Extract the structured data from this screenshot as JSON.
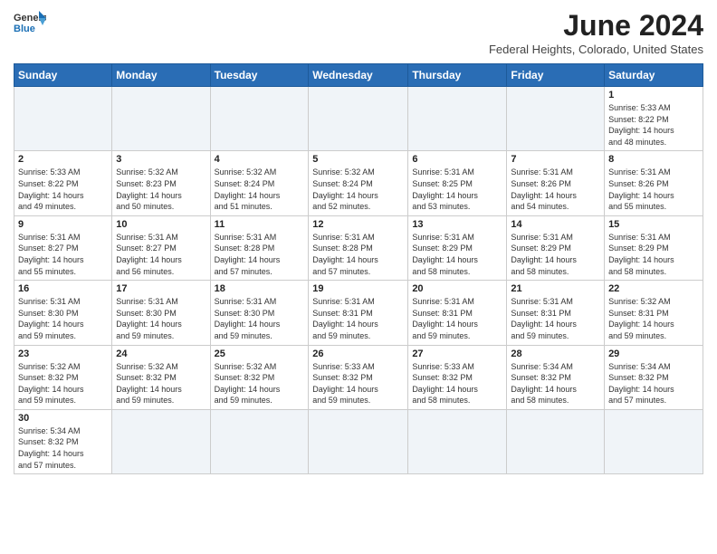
{
  "header": {
    "logo_line1": "General",
    "logo_line2": "Blue",
    "month_title": "June 2024",
    "location": "Federal Heights, Colorado, United States"
  },
  "weekdays": [
    "Sunday",
    "Monday",
    "Tuesday",
    "Wednesday",
    "Thursday",
    "Friday",
    "Saturday"
  ],
  "weeks": [
    [
      {
        "day": "",
        "info": ""
      },
      {
        "day": "",
        "info": ""
      },
      {
        "day": "",
        "info": ""
      },
      {
        "day": "",
        "info": ""
      },
      {
        "day": "",
        "info": ""
      },
      {
        "day": "",
        "info": ""
      },
      {
        "day": "1",
        "info": "Sunrise: 5:33 AM\nSunset: 8:22 PM\nDaylight: 14 hours\nand 48 minutes."
      }
    ],
    [
      {
        "day": "2",
        "info": "Sunrise: 5:33 AM\nSunset: 8:22 PM\nDaylight: 14 hours\nand 49 minutes."
      },
      {
        "day": "3",
        "info": "Sunrise: 5:32 AM\nSunset: 8:23 PM\nDaylight: 14 hours\nand 50 minutes."
      },
      {
        "day": "4",
        "info": "Sunrise: 5:32 AM\nSunset: 8:24 PM\nDaylight: 14 hours\nand 51 minutes."
      },
      {
        "day": "5",
        "info": "Sunrise: 5:32 AM\nSunset: 8:24 PM\nDaylight: 14 hours\nand 52 minutes."
      },
      {
        "day": "6",
        "info": "Sunrise: 5:31 AM\nSunset: 8:25 PM\nDaylight: 14 hours\nand 53 minutes."
      },
      {
        "day": "7",
        "info": "Sunrise: 5:31 AM\nSunset: 8:26 PM\nDaylight: 14 hours\nand 54 minutes."
      },
      {
        "day": "8",
        "info": "Sunrise: 5:31 AM\nSunset: 8:26 PM\nDaylight: 14 hours\nand 55 minutes."
      }
    ],
    [
      {
        "day": "9",
        "info": "Sunrise: 5:31 AM\nSunset: 8:27 PM\nDaylight: 14 hours\nand 55 minutes."
      },
      {
        "day": "10",
        "info": "Sunrise: 5:31 AM\nSunset: 8:27 PM\nDaylight: 14 hours\nand 56 minutes."
      },
      {
        "day": "11",
        "info": "Sunrise: 5:31 AM\nSunset: 8:28 PM\nDaylight: 14 hours\nand 57 minutes."
      },
      {
        "day": "12",
        "info": "Sunrise: 5:31 AM\nSunset: 8:28 PM\nDaylight: 14 hours\nand 57 minutes."
      },
      {
        "day": "13",
        "info": "Sunrise: 5:31 AM\nSunset: 8:29 PM\nDaylight: 14 hours\nand 58 minutes."
      },
      {
        "day": "14",
        "info": "Sunrise: 5:31 AM\nSunset: 8:29 PM\nDaylight: 14 hours\nand 58 minutes."
      },
      {
        "day": "15",
        "info": "Sunrise: 5:31 AM\nSunset: 8:29 PM\nDaylight: 14 hours\nand 58 minutes."
      }
    ],
    [
      {
        "day": "16",
        "info": "Sunrise: 5:31 AM\nSunset: 8:30 PM\nDaylight: 14 hours\nand 59 minutes."
      },
      {
        "day": "17",
        "info": "Sunrise: 5:31 AM\nSunset: 8:30 PM\nDaylight: 14 hours\nand 59 minutes."
      },
      {
        "day": "18",
        "info": "Sunrise: 5:31 AM\nSunset: 8:30 PM\nDaylight: 14 hours\nand 59 minutes."
      },
      {
        "day": "19",
        "info": "Sunrise: 5:31 AM\nSunset: 8:31 PM\nDaylight: 14 hours\nand 59 minutes."
      },
      {
        "day": "20",
        "info": "Sunrise: 5:31 AM\nSunset: 8:31 PM\nDaylight: 14 hours\nand 59 minutes."
      },
      {
        "day": "21",
        "info": "Sunrise: 5:31 AM\nSunset: 8:31 PM\nDaylight: 14 hours\nand 59 minutes."
      },
      {
        "day": "22",
        "info": "Sunrise: 5:32 AM\nSunset: 8:31 PM\nDaylight: 14 hours\nand 59 minutes."
      }
    ],
    [
      {
        "day": "23",
        "info": "Sunrise: 5:32 AM\nSunset: 8:32 PM\nDaylight: 14 hours\nand 59 minutes."
      },
      {
        "day": "24",
        "info": "Sunrise: 5:32 AM\nSunset: 8:32 PM\nDaylight: 14 hours\nand 59 minutes."
      },
      {
        "day": "25",
        "info": "Sunrise: 5:32 AM\nSunset: 8:32 PM\nDaylight: 14 hours\nand 59 minutes."
      },
      {
        "day": "26",
        "info": "Sunrise: 5:33 AM\nSunset: 8:32 PM\nDaylight: 14 hours\nand 59 minutes."
      },
      {
        "day": "27",
        "info": "Sunrise: 5:33 AM\nSunset: 8:32 PM\nDaylight: 14 hours\nand 58 minutes."
      },
      {
        "day": "28",
        "info": "Sunrise: 5:34 AM\nSunset: 8:32 PM\nDaylight: 14 hours\nand 58 minutes."
      },
      {
        "day": "29",
        "info": "Sunrise: 5:34 AM\nSunset: 8:32 PM\nDaylight: 14 hours\nand 57 minutes."
      }
    ],
    [
      {
        "day": "30",
        "info": "Sunrise: 5:34 AM\nSunset: 8:32 PM\nDaylight: 14 hours\nand 57 minutes."
      },
      {
        "day": "",
        "info": ""
      },
      {
        "day": "",
        "info": ""
      },
      {
        "day": "",
        "info": ""
      },
      {
        "day": "",
        "info": ""
      },
      {
        "day": "",
        "info": ""
      },
      {
        "day": "",
        "info": ""
      }
    ]
  ]
}
